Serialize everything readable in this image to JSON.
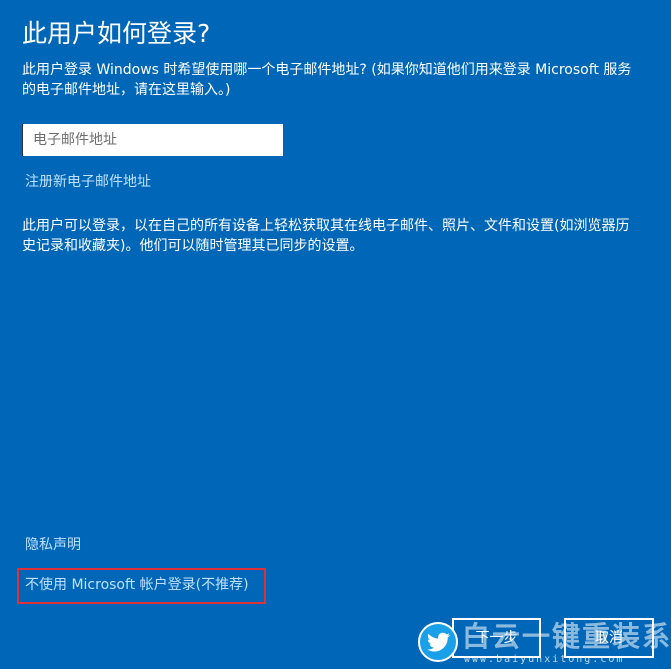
{
  "header": {
    "title": "此用户如何登录?"
  },
  "intro": {
    "text": "此用户登录 Windows 时希望使用哪一个电子邮件地址? (如果你知道他们用来登录 Microsoft 服务的电子邮件地址，请在这里输入。)"
  },
  "email": {
    "placeholder": "电子邮件地址",
    "value": ""
  },
  "links": {
    "register": "注册新电子邮件地址",
    "privacy": "隐私声明",
    "no_microsoft": "不使用 Microsoft 帐户登录(不推荐)"
  },
  "description": {
    "text": "此用户可以登录，以在自己的所有设备上轻松获取其在线电子邮件、照片、文件和设置(如浏览器历史记录和收藏夹)。他们可以随时管理其已同步的设置。"
  },
  "buttons": {
    "next": "下一步",
    "cancel": "取消"
  },
  "watermark": {
    "logo_icon": "bird-icon",
    "name": "白云一键重装系统",
    "url": "www.baiyunxitong.com"
  },
  "colors": {
    "background": "#0067b8",
    "link": "#bfe0ff",
    "highlight_border": "#e0303a"
  }
}
